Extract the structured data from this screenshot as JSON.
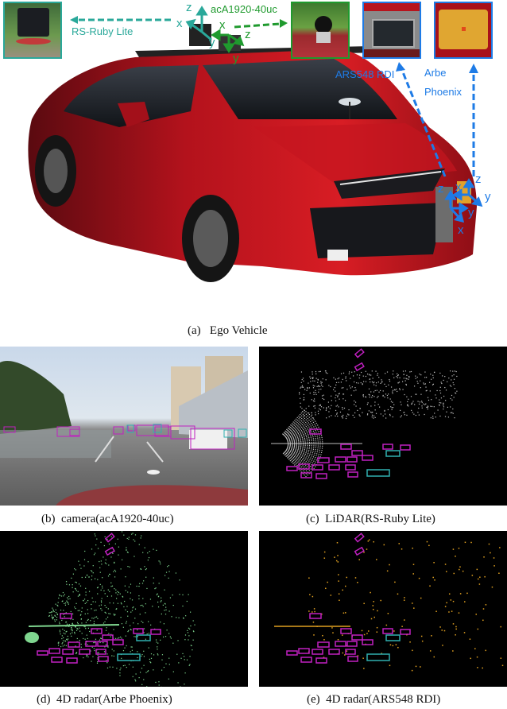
{
  "figure": {
    "panel_a": {
      "caption_tag": "(a)",
      "caption_text": "Ego Vehicle",
      "sensors": {
        "lidar": {
          "label": "RS-Ruby Lite",
          "color": "#2aa89a"
        },
        "camera": {
          "label": "acA1920-40uc",
          "color": "#1f9a2e"
        },
        "radar_ars": {
          "label": "ARS548 RDI",
          "color": "#1e7be6"
        },
        "radar_arbe": {
          "label_line1": "Arbe",
          "label_line2": "Phoenix",
          "color": "#1e7be6"
        }
      },
      "axes": {
        "lidar": {
          "x": "x",
          "y": "y",
          "z": "z"
        },
        "camera": {
          "x": "x",
          "y": "y",
          "z": "z"
        },
        "radar_ars": {
          "x": "x",
          "y": "y",
          "z": "z"
        },
        "radar_arbe": {
          "x": "x",
          "y": "y",
          "z": "z"
        }
      }
    },
    "panel_b": {
      "caption_tag": "(b)",
      "caption_text": "camera(acA1920-40uc)"
    },
    "panel_c": {
      "caption_tag": "(c)",
      "caption_text": "LiDAR(RS-Ruby Lite)",
      "point_color": "#bdbdbd"
    },
    "panel_d": {
      "caption_tag": "(d)",
      "caption_text": "4D radar(Arbe Phoenix)",
      "point_color": "#7fd68f"
    },
    "panel_e": {
      "caption_tag": "(e)",
      "caption_text": "4D radar(ARS548 RDI)",
      "point_color": "#e0a020"
    },
    "box_colors": {
      "car": "#c020c0",
      "truck": "#30b0b0"
    }
  }
}
